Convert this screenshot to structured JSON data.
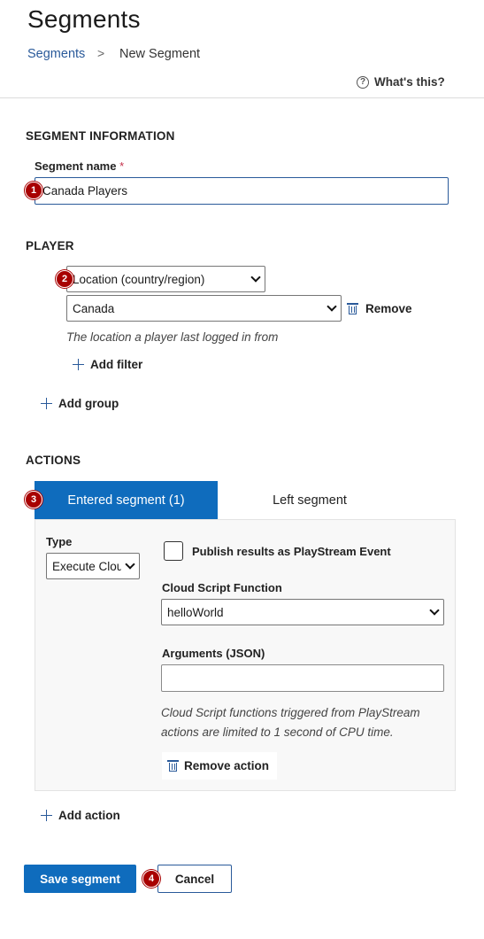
{
  "page": {
    "title": "Segments"
  },
  "breadcrumb": {
    "link": "Segments",
    "separator": ">",
    "current": "New Segment"
  },
  "help": {
    "icon": "question-circle-icon",
    "label": "What's this?"
  },
  "segment_info": {
    "heading": "SEGMENT INFORMATION",
    "name_label": "Segment name",
    "required_mark": "*",
    "name_value": "Canada Players"
  },
  "player": {
    "heading": "PLAYER",
    "filter_type": "Location (country/region)",
    "filter_value": "Canada",
    "remove_label": "Remove",
    "hint": "The location a player last logged in from",
    "add_filter_label": "Add filter",
    "add_group_label": "Add group"
  },
  "actions": {
    "heading": "ACTIONS",
    "tabs": [
      {
        "label": "Entered segment (1)",
        "active": true
      },
      {
        "label": "Left segment",
        "active": false
      }
    ],
    "type_label": "Type",
    "type_value": "Execute Cloud Script",
    "publish_label": "Publish results as PlayStream Event",
    "publish_checked": false,
    "function_label": "Cloud Script Function",
    "function_value": "helloWorld",
    "arguments_label": "Arguments (JSON)",
    "arguments_value": "",
    "cpu_hint": "Cloud Script functions triggered from PlayStream actions are limited to 1 second of CPU time.",
    "remove_action_label": "Remove action",
    "add_action_label": "Add action"
  },
  "footer": {
    "save_label": "Save segment",
    "cancel_label": "Cancel"
  },
  "badges": [
    "1",
    "2",
    "3",
    "4"
  ],
  "colors": {
    "primary": "#0f6cbd",
    "link": "#2a5a9a",
    "badge": "#a80000"
  }
}
